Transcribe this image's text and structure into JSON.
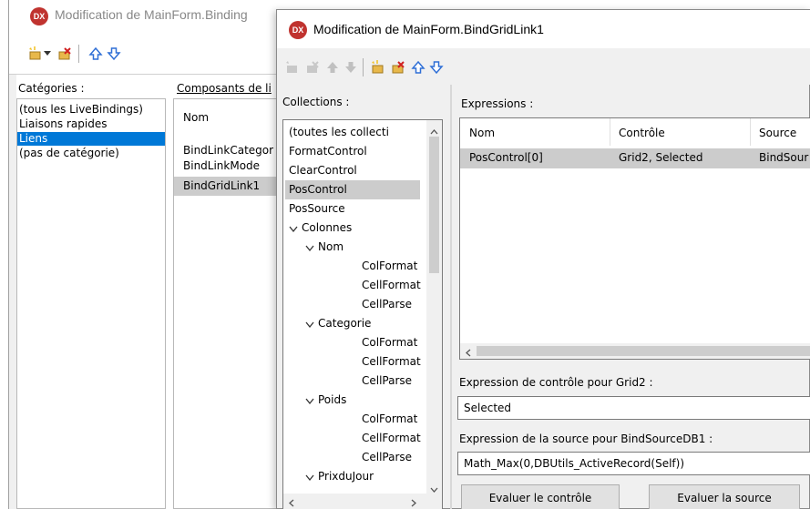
{
  "back_window": {
    "title": "Modification de MainForm.Binding",
    "categories_label": "Catégories :",
    "categories": [
      "(tous les LiveBindings)",
      "Liaisons rapides",
      "Liens",
      "(pas de catégorie)"
    ],
    "components_label": "Composants de li",
    "components_header": "Nom",
    "components": [
      "BindLinkCategor",
      "BindLinkMode",
      "BindGridLink1"
    ]
  },
  "front_window": {
    "title": "Modification de MainForm.BindGridLink1",
    "logo": "DX",
    "collections_label": "Collections :",
    "collections": {
      "all": "(toutes les collecti",
      "format_control": "FormatControl",
      "clear_control": "ClearControl",
      "pos_control": "PosControl",
      "pos_source": "PosSource",
      "colonnes": "Colonnes",
      "nom": "Nom",
      "nom_colformat": "ColFormat",
      "nom_cellformat": "CellFormat",
      "nom_cellparse": "CellParse",
      "categorie": "Categorie",
      "cat_colformat": "ColFormat",
      "cat_cellformat": "CellFormat",
      "cat_cellparse": "CellParse",
      "poids": "Poids",
      "poids_colformat": "ColFormat",
      "poids_cellformat": "CellFormat",
      "poids_cellparse": "CellParse",
      "prixdujour": "PrixduJour"
    },
    "expressions_label": "Expressions :",
    "expressions_columns": [
      "Nom",
      "Contrôle",
      "Source"
    ],
    "expressions_rows": [
      {
        "nom": "PosControl[0]",
        "controle": "Grid2, Selected",
        "source": "BindSour"
      }
    ],
    "control_expr_label": "Expression de contrôle pour Grid2 :",
    "control_expr_value": "Selected",
    "source_expr_label": "Expression de la source pour BindSourceDB1 :",
    "source_expr_value": "Math_Max(0,DBUtils_ActiveRecord(Self))",
    "eval_control_button": "Evaluer le contrôle",
    "eval_source_button": "Evaluer la source"
  },
  "colors": {
    "selection_blue": "#0078d7",
    "selection_gray": "#cccccc",
    "logo_red": "#c0332f",
    "arrow_blue": "#2f6fd6"
  },
  "icons": [
    "new-item-icon",
    "delete-item-icon",
    "move-up-icon",
    "move-down-icon",
    "expand-chevron-icon",
    "scroll-up-icon",
    "scroll-down-icon",
    "scroll-left-icon",
    "scroll-right-icon"
  ]
}
